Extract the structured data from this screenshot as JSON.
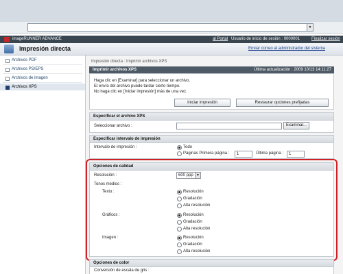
{
  "address": {
    "dropdown_icon": "chevron-down-icon"
  },
  "brandbar": {
    "product": "imageRUNNER ADVANCE",
    "portal_link": "al Portal",
    "user_info": "Usuario de inicio de sesión : 0000001",
    "logout_link": "Finalizar sesión"
  },
  "header": {
    "title": "Impresión directa",
    "admin_link": "Enviar correo al administrador del sistema"
  },
  "sidebar": {
    "items": [
      {
        "label": "Archivos PDF"
      },
      {
        "label": "Archivos PS/EPS"
      },
      {
        "label": "Archivos de imagen"
      },
      {
        "label": "Archivos XPS"
      }
    ]
  },
  "breadcrumb": "Impresión directa : Imprimir archivos XPS",
  "print_panel": {
    "title": "Imprimir archivos XPS",
    "updated": "Última actualización : 2009 10/13 14:11:27",
    "messages": [
      "Haga clic en [Examinar] para seleccionar un archivo.",
      "El envío del archivo puede tardar cierto tiempo.",
      "No haga clic en [Iniciar impresión] más de una vez."
    ],
    "start_button": "Iniciar impresión",
    "restore_button": "Restaurar opciones prefijadas"
  },
  "file_section": {
    "title": "Especificar el archivo XPS",
    "label": "Seleccionar archivo :",
    "browse_button": "Examinar..."
  },
  "range_section": {
    "title": "Especificar intervalo de impresión",
    "label": "Intervalo de impresión :",
    "option_all": "Todo",
    "option_pages": "Páginas Primera página :",
    "first_page": "1",
    "last_label": "Última página :",
    "last_page": "1"
  },
  "quality_section": {
    "title": "Opciones de calidad",
    "resolution_label": "Resolución :",
    "resolution_value": "600 ppp",
    "tones_label": "Tonos medios :",
    "text_label": "Texto :",
    "graphics_label": "Gráficos :",
    "image_label": "Imagen :",
    "options": [
      "Resolución",
      "Gradación",
      "Alta resolución"
    ]
  },
  "color_section": {
    "title": "Opciones de color",
    "grayscale_label": "Conversión de escala de gris :"
  }
}
